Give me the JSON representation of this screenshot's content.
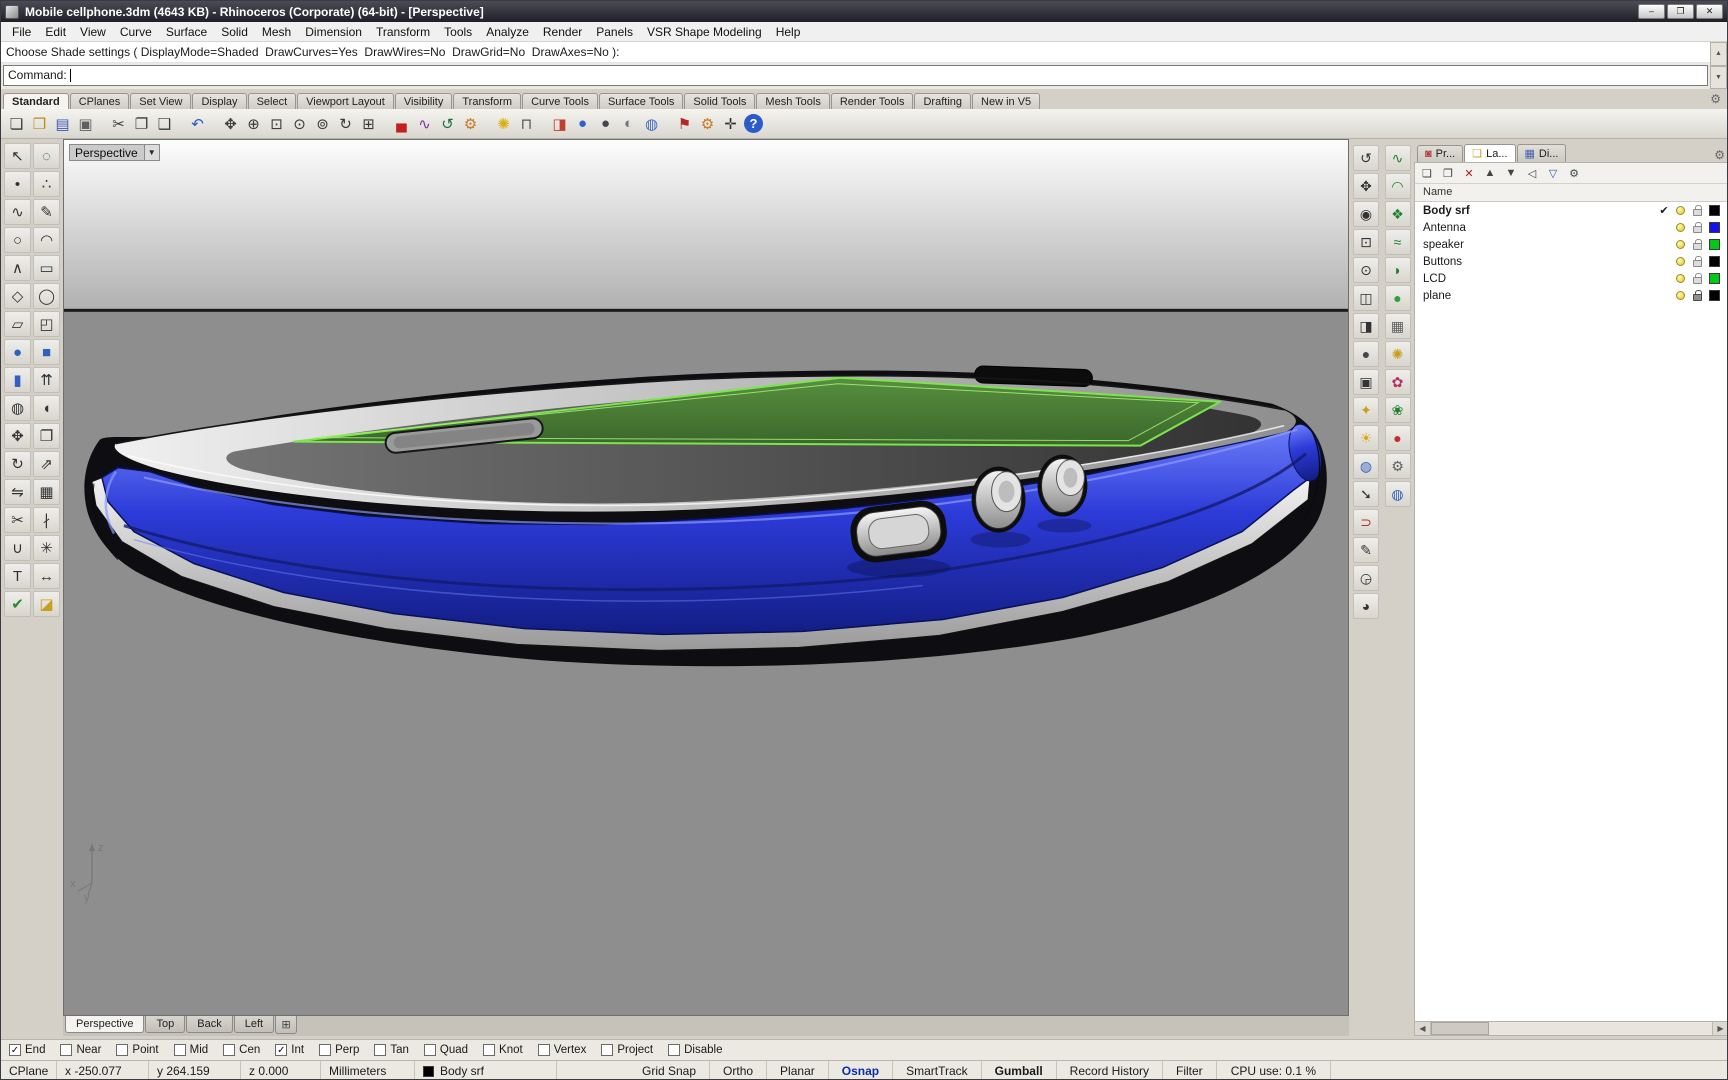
{
  "window": {
    "title": "Mobile cellphone.3dm (4643 KB) - Rhinoceros (Corporate) (64-bit) - [Perspective]",
    "buttons": [
      {
        "name": "minimize-button",
        "glyph": "–"
      },
      {
        "name": "restore-button",
        "glyph": "❐"
      },
      {
        "name": "close-button",
        "glyph": "✕"
      }
    ]
  },
  "menu": {
    "items": [
      "File",
      "Edit",
      "View",
      "Curve",
      "Surface",
      "Solid",
      "Mesh",
      "Dimension",
      "Transform",
      "Tools",
      "Analyze",
      "Render",
      "Panels",
      "VSR Shape Modeling",
      "Help"
    ]
  },
  "command": {
    "history_line": "Choose Shade settings ( DisplayMode=Shaded  DrawCurves=Yes  DrawWires=No  DrawGrid=No  DrawAxes=No ):",
    "prompt_label": "Command:",
    "scroll_up": "▲",
    "scroll_down": "▼"
  },
  "toolbar_tabs": {
    "options_icon": "⚙",
    "items": [
      {
        "label": "Standard",
        "active": true
      },
      {
        "label": "CPlanes"
      },
      {
        "label": "Set View"
      },
      {
        "label": "Display"
      },
      {
        "label": "Select"
      },
      {
        "label": "Viewport Layout"
      },
      {
        "label": "Visibility"
      },
      {
        "label": "Transform"
      },
      {
        "label": "Curve Tools"
      },
      {
        "label": "Surface Tools"
      },
      {
        "label": "Solid Tools"
      },
      {
        "label": "Mesh Tools"
      },
      {
        "label": "Render Tools"
      },
      {
        "label": "Drafting"
      },
      {
        "label": "New in V5"
      }
    ]
  },
  "main_toolbar": {
    "icons": [
      {
        "name": "new-file-icon",
        "glyph": "❏"
      },
      {
        "name": "open-folder-icon",
        "glyph": "❒",
        "color": "#c08a20"
      },
      {
        "name": "save-icon",
        "glyph": "▤",
        "color": "#3858c0"
      },
      {
        "name": "print-icon",
        "glyph": "▣",
        "color": "#606060"
      },
      {
        "name": "cut-icon",
        "glyph": "✂",
        "gap": true
      },
      {
        "name": "copy-icon",
        "glyph": "❐"
      },
      {
        "name": "paste-icon",
        "glyph": "❑"
      },
      {
        "name": "undo-icon",
        "glyph": "↶",
        "color": "#2858c8",
        "gap": true
      },
      {
        "name": "pan-hand-icon",
        "glyph": "✥",
        "gap": true
      },
      {
        "name": "zoom-dynamic-icon",
        "glyph": "⊕"
      },
      {
        "name": "zoom-window-icon",
        "glyph": "⊡"
      },
      {
        "name": "zoom-extents-icon",
        "glyph": "⊙"
      },
      {
        "name": "zoom-selected-icon",
        "glyph": "⊚"
      },
      {
        "name": "rotate-view-icon",
        "glyph": "↻"
      },
      {
        "name": "grid-table-icon",
        "glyph": "⊞"
      },
      {
        "name": "car-icon",
        "glyph": "▄",
        "color": "#c02020",
        "gap": true
      },
      {
        "name": "show-edges-icon",
        "glyph": "∿",
        "color": "#8030a0"
      },
      {
        "name": "rotate-cplane-icon",
        "glyph": "↺",
        "color": "#207040"
      },
      {
        "name": "gear-plus-icon",
        "glyph": "⚙",
        "color": "#c87820"
      },
      {
        "name": "lightbulb-icon",
        "glyph": "✺",
        "color": "#d8b010",
        "gap": true
      },
      {
        "name": "lock-icon",
        "glyph": "⊓",
        "color": "#555555"
      },
      {
        "name": "render-icon",
        "glyph": "◨",
        "color": "#c04030",
        "gap": true
      },
      {
        "name": "render-preview-icon",
        "glyph": "●",
        "color": "#3060d0"
      },
      {
        "name": "shaded-viewport-icon",
        "glyph": "●",
        "color": "#46464e"
      },
      {
        "name": "ghosted-viewport-icon",
        "glyph": "◐",
        "color": "#74747c"
      },
      {
        "name": "rendered-viewport-icon",
        "glyph": "◍",
        "color": "#3868c8"
      },
      {
        "name": "notes-flag-icon",
        "glyph": "⚑",
        "color": "#b02828",
        "gap": true
      },
      {
        "name": "settings-gears-icon",
        "glyph": "⚙",
        "color": "#c87820"
      },
      {
        "name": "cplane-axes-icon",
        "glyph": "✛",
        "color": "#303030"
      },
      {
        "name": "help-icon",
        "glyph": "?",
        "round": true
      }
    ]
  },
  "left_toolbar": {
    "icons": [
      {
        "name": "select-icon",
        "glyph": "↖"
      },
      {
        "name": "lasso-select-icon",
        "glyph": "◌"
      },
      {
        "name": "point-icon",
        "glyph": "•"
      },
      {
        "name": "point-cloud-icon",
        "glyph": "∴"
      },
      {
        "name": "curve-icon",
        "glyph": "∿"
      },
      {
        "name": "sketch-icon",
        "glyph": "✎"
      },
      {
        "name": "circle-icon",
        "glyph": "○"
      },
      {
        "name": "arc-icon",
        "glyph": "◠"
      },
      {
        "name": "polyline-icon",
        "glyph": "∧"
      },
      {
        "name": "rectangle-icon",
        "glyph": "▭"
      },
      {
        "name": "polygon-icon",
        "glyph": "◇"
      },
      {
        "name": "ellipse-icon",
        "glyph": "◯"
      },
      {
        "name": "plane-icon",
        "glyph": "▱"
      },
      {
        "name": "surface-corner-icon",
        "glyph": "◰"
      },
      {
        "name": "sphere-icon",
        "glyph": "●",
        "color": "#3060c0"
      },
      {
        "name": "box-icon",
        "glyph": "■",
        "color": "#3060c0"
      },
      {
        "name": "cylinder-icon",
        "glyph": "▮",
        "color": "#3060c0"
      },
      {
        "name": "extrude-icon",
        "glyph": "⇈"
      },
      {
        "name": "boolean-icon",
        "glyph": "◍"
      },
      {
        "name": "fillet-surface-icon",
        "glyph": "◖"
      },
      {
        "name": "move-icon",
        "glyph": "✥"
      },
      {
        "name": "copy-icon",
        "glyph": "❐"
      },
      {
        "name": "rotate-icon",
        "glyph": "↻"
      },
      {
        "name": "scale-icon",
        "glyph": "⇗"
      },
      {
        "name": "mirror-icon",
        "glyph": "⇋"
      },
      {
        "name": "array-icon",
        "glyph": "▦"
      },
      {
        "name": "trim-icon",
        "glyph": "✂"
      },
      {
        "name": "split-icon",
        "glyph": "∤"
      },
      {
        "name": "join-icon",
        "glyph": "∪"
      },
      {
        "name": "explode-icon",
        "glyph": "✳"
      },
      {
        "name": "text-icon",
        "glyph": "T"
      },
      {
        "name": "dimension-icon",
        "glyph": "↔"
      },
      {
        "name": "check-icon",
        "glyph": "✔",
        "color": "#2a8a2a"
      },
      {
        "name": "wedge-icon",
        "glyph": "◪",
        "color": "#c8a020"
      }
    ]
  },
  "right_toolbar_a": {
    "icons": [
      {
        "name": "view-rotate-icon",
        "glyph": "↺"
      },
      {
        "name": "view-pan-icon",
        "glyph": "✥"
      },
      {
        "name": "view-zoom-icon",
        "glyph": "◉"
      },
      {
        "name": "view-zoom-window-icon",
        "glyph": "⊡"
      },
      {
        "name": "view-zoom-extents-icon",
        "glyph": "⊙"
      },
      {
        "name": "viewport-layout-icon",
        "glyph": "◫"
      },
      {
        "name": "display-mode-icon",
        "glyph": "◨"
      },
      {
        "name": "shade-mode-icon",
        "glyph": "●",
        "color": "#46464e"
      },
      {
        "name": "camera-icon",
        "glyph": "▣"
      },
      {
        "name": "spotlight-icon",
        "glyph": "✦",
        "color": "#c8a020"
      },
      {
        "name": "sun-icon",
        "glyph": "☀",
        "color": "#d8a818"
      },
      {
        "name": "render-globe-icon",
        "glyph": "◍",
        "color": "#3060c0"
      },
      {
        "name": "arrow-tool-icon",
        "glyph": "➘"
      },
      {
        "name": "magnet-icon",
        "glyph": "⊃",
        "color": "#b03030"
      },
      {
        "name": "pencil-icon",
        "glyph": "✎"
      },
      {
        "name": "protractor-icon",
        "glyph": "◶"
      },
      {
        "name": "eye-icon",
        "glyph": "◕"
      }
    ]
  },
  "right_toolbar_b": {
    "icons": [
      {
        "name": "vsr-curve-icon",
        "glyph": "∿",
        "color": "#208030"
      },
      {
        "name": "vsr-blend-icon",
        "glyph": "◠",
        "color": "#208030"
      },
      {
        "name": "vsr-surface-icon",
        "glyph": "❖",
        "color": "#208030"
      },
      {
        "name": "vsr-match-icon",
        "glyph": "≈",
        "color": "#208030"
      },
      {
        "name": "vsr-fillet-icon",
        "glyph": "◗",
        "color": "#208030"
      },
      {
        "name": "vsr-sphere-icon",
        "glyph": "●",
        "color": "#30a040"
      },
      {
        "name": "vsr-panel-icon",
        "glyph": "▦",
        "color": "#606060"
      },
      {
        "name": "vsr-light-icon",
        "glyph": "✺",
        "color": "#c8a020"
      },
      {
        "name": "vsr-flower-icon",
        "glyph": "✿",
        "color": "#b03060"
      },
      {
        "name": "vsr-leaf-icon",
        "glyph": "❀",
        "color": "#208030"
      },
      {
        "name": "vsr-ball-icon",
        "glyph": "●",
        "color": "#c03030"
      },
      {
        "name": "vsr-gear-icon",
        "glyph": "⚙",
        "color": "#606060"
      },
      {
        "name": "vsr-globe-icon",
        "glyph": "◍",
        "color": "#3060c0"
      }
    ]
  },
  "viewport": {
    "label": "Perspective",
    "dropdown_icon": "▼",
    "axis_labels": {
      "x": "x",
      "y": "y",
      "z": "z"
    },
    "tabs": {
      "items": [
        {
          "label": "Perspective",
          "active": true
        },
        {
          "label": "Top"
        },
        {
          "label": "Back"
        },
        {
          "label": "Left"
        }
      ],
      "new_tab_icon": "⊞"
    }
  },
  "layers_panel": {
    "tabs": [
      {
        "label": "Pr...",
        "glyph": "◙",
        "color": "#b04040"
      },
      {
        "label": "La...",
        "glyph": "❏",
        "color": "#c8a020",
        "active": true
      },
      {
        "label": "Di...",
        "glyph": "▦",
        "color": "#4060b0"
      }
    ],
    "options_icon": "⚙",
    "toolbar": [
      {
        "name": "new-layer-icon",
        "glyph": "❏"
      },
      {
        "name": "new-sublayer-icon",
        "glyph": "❐"
      },
      {
        "name": "delete-layer-icon",
        "glyph": "✕",
        "color": "#b02020"
      },
      {
        "name": "move-up-icon",
        "glyph": "▲"
      },
      {
        "name": "move-down-icon",
        "glyph": "▼"
      },
      {
        "name": "expand-icon",
        "glyph": "◁"
      },
      {
        "name": "filter-icon",
        "glyph": "▽",
        "color": "#3858a8"
      },
      {
        "name": "layer-tools-icon",
        "glyph": "⚙"
      }
    ],
    "name_header": "Name",
    "check_glyph": "✔",
    "scroll_left": "◀",
    "scroll_right": "▶",
    "rows": [
      {
        "name": "Body srf",
        "bold": true,
        "current": true,
        "on": true,
        "locked": false,
        "color": "#000000"
      },
      {
        "name": "Antenna",
        "current": false,
        "on": true,
        "locked": false,
        "color": "#1414e6"
      },
      {
        "name": "speaker",
        "current": false,
        "on": true,
        "locked": false,
        "color": "#00c814"
      },
      {
        "name": "Buttons",
        "current": false,
        "on": true,
        "locked": false,
        "color": "#000000"
      },
      {
        "name": "LCD",
        "current": false,
        "on": true,
        "locked": false,
        "color": "#00c814"
      },
      {
        "name": "plane",
        "current": false,
        "on": true,
        "locked": true,
        "color": "#000000"
      }
    ]
  },
  "osnap": {
    "items": [
      {
        "label": "End",
        "checked": true
      },
      {
        "label": "Near"
      },
      {
        "label": "Point"
      },
      {
        "label": "Mid"
      },
      {
        "label": "Cen"
      },
      {
        "label": "Int",
        "checked": true
      },
      {
        "label": "Perp"
      },
      {
        "label": "Tan"
      },
      {
        "label": "Quad"
      },
      {
        "label": "Knot"
      },
      {
        "label": "Vertex"
      },
      {
        "label": "Project"
      },
      {
        "label": "Disable"
      }
    ]
  },
  "status_bar": {
    "cplane": "CPlane",
    "coords": {
      "x": "x -250.077",
      "y": "y 264.159",
      "z": "z 0.000"
    },
    "units": "Millimeters",
    "active_layer": {
      "name": "Body srf",
      "color": "#000000"
    },
    "toggles": [
      {
        "label": "Grid Snap"
      },
      {
        "label": "Ortho"
      },
      {
        "label": "Planar"
      },
      {
        "label": "Osnap",
        "blue": true,
        "bold": true
      },
      {
        "label": "SmartTrack"
      },
      {
        "label": "Gumball",
        "bold": true
      },
      {
        "label": "Record History"
      },
      {
        "label": "Filter"
      }
    ],
    "cpu": "CPU use: 0.1 %"
  }
}
